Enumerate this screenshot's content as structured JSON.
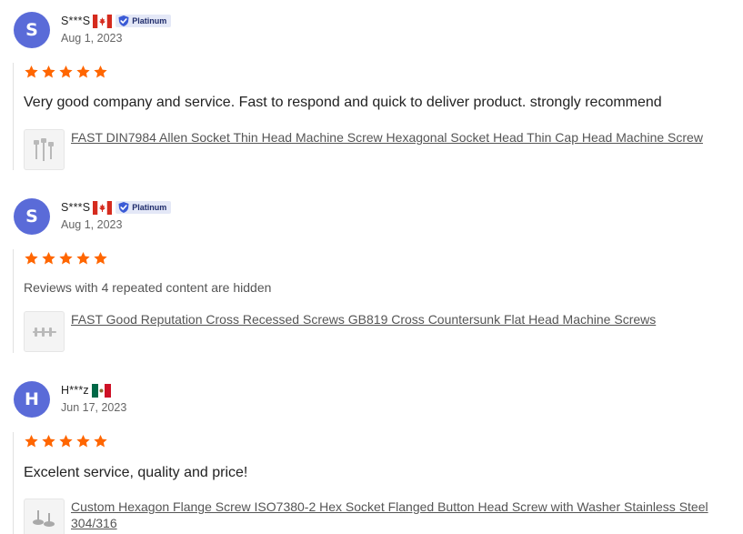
{
  "reviews": [
    {
      "initial": "S",
      "username": "S***S",
      "country_flag": "canada-flag-icon",
      "badge": "Platinum",
      "date": "Aug 1, 2023",
      "rating": 5,
      "text": "Very good company and service. Fast to respond and quick to deliver product. strongly recommend",
      "product": "FAST DIN7984 Allen Socket Thin Head Machine Screw Hexagonal Socket Head Thin Cap Head Machine Screw"
    },
    {
      "initial": "S",
      "username": "S***S",
      "country_flag": "canada-flag-icon",
      "badge": "Platinum",
      "date": "Aug 1, 2023",
      "rating": 5,
      "text": "Reviews with 4 repeated content are hidden",
      "product": "FAST Good Reputation Cross Recessed Screws GB819 Cross Countersunk Flat Head Machine Screws"
    },
    {
      "initial": "H",
      "username": "H***z",
      "country_flag": "mexico-flag-icon",
      "date": "Jun 17, 2023",
      "rating": 5,
      "text": "Excelent service, quality and price!",
      "product": "Custom Hexagon Flange Screw ISO7380-2 Hex Socket Flanged Button Head Screw with Washer Stainless Steel 304/316"
    }
  ],
  "colors": {
    "avatar": "#5a6bd8",
    "star": "#ff6600",
    "badge_bg": "#e4e8f7",
    "badge_text": "#1f2c6b"
  }
}
